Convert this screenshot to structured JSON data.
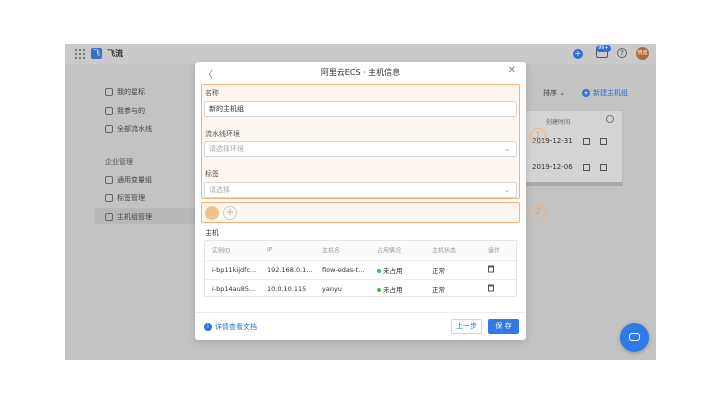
{
  "app": {
    "name": "飞流",
    "logo_char": "飞"
  },
  "topbar": {
    "badge": "99+",
    "help": "?",
    "avatar": "晓迪",
    "plus": "+"
  },
  "sidebar": {
    "items": [
      {
        "label": "我的星标"
      },
      {
        "label": "我参与的"
      },
      {
        "label": "全部流水线"
      }
    ],
    "section": "企业管理",
    "admin_items": [
      {
        "label": "通用变量组"
      },
      {
        "label": "标签管理"
      },
      {
        "label": "主机组管理"
      }
    ]
  },
  "background": {
    "sort_label": "排序 ⌄",
    "new_button": "新建主机组",
    "column_header": "创建时间",
    "rows": [
      {
        "date": "2019-12-31"
      },
      {
        "date": "2019-12-06"
      }
    ]
  },
  "modal": {
    "back": "〈",
    "title": "阿里云ECS · 主机信息",
    "close": "✕",
    "name_label": "名称",
    "name_value": "新的主机组",
    "env_label": "流水线环境",
    "env_placeholder": "请选择环境",
    "tag_label": "标签",
    "tag_placeholder": "请选择",
    "host_label": "主机",
    "table": {
      "headers": [
        "实例ID",
        "IP",
        "主机名",
        "占用情况",
        "主机状态",
        "操作"
      ],
      "rows": [
        {
          "id": "i-bp11kijdfc...",
          "ip": "192.168.0.1...",
          "hostname": "flow-edas-t...",
          "usage": "未占用",
          "status": "正常"
        },
        {
          "id": "i-bp14au85...",
          "ip": "10.0.10.115",
          "hostname": "yanyu",
          "usage": "未占用",
          "status": "正常"
        }
      ]
    },
    "doc_link": "详情查看文档",
    "prev_button": "上一步",
    "save_button": "保 存"
  },
  "annotations": {
    "one": "1",
    "two": "2"
  },
  "colors": {
    "accent": "#2f7be5",
    "highlight": "#f2b27a",
    "ok": "#3fb950"
  }
}
